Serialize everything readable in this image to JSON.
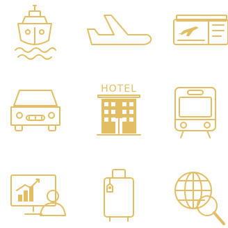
{
  "icons": [
    {
      "name": "cruise-ship-icon"
    },
    {
      "name": "airplane-icon"
    },
    {
      "name": "flight-ticket-icon"
    },
    {
      "name": "taxi-car-icon"
    },
    {
      "name": "hotel-icon",
      "label": "HOTEL"
    },
    {
      "name": "train-icon"
    },
    {
      "name": "presentation-chart-icon"
    },
    {
      "name": "luggage-icon"
    },
    {
      "name": "globe-search-icon"
    }
  ],
  "colors": {
    "accent": "#e2bd63",
    "background": "#ffffff"
  }
}
